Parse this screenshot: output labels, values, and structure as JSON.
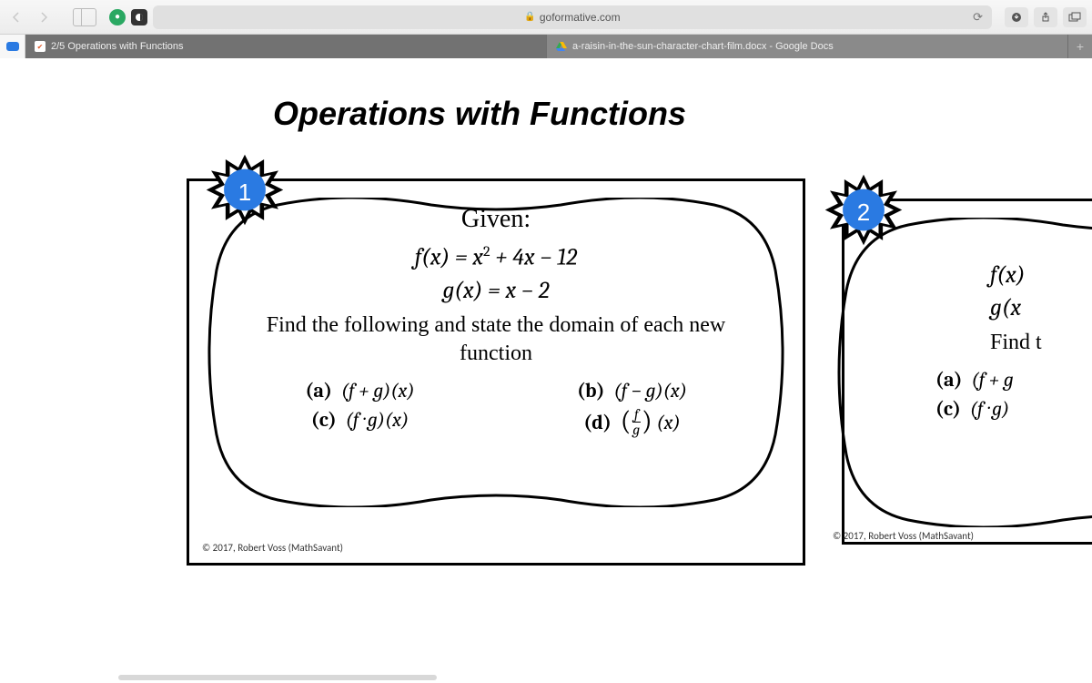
{
  "browser": {
    "url_host": "goformative.com",
    "tabs": [
      {
        "title": "2/5 Operations with Functions",
        "active": true,
        "favicon": "check"
      },
      {
        "title": "a-raisin-in-the-sun-character-chart-film.docx - Google Docs",
        "active": false,
        "favicon": "drive"
      }
    ]
  },
  "page": {
    "title": "Operations with Functions"
  },
  "cards": [
    {
      "number": "1",
      "given_label": "Given:",
      "f_def": "f(x) = x² + 4x − 12",
      "g_def": "g(x) = x − 2",
      "prompt": "Find the following and state the domain of each new function",
      "options": {
        "a": "(f + g)(x)",
        "b": "(f − g)(x)",
        "c": "(f · g)(x)",
        "d_open": "(",
        "d_num": "f",
        "d_den": "g",
        "d_close": ") (x)"
      },
      "copyright": "© 2017, Robert Voss (MathSavant)"
    },
    {
      "number": "2",
      "f_partial": "f(x)",
      "g_partial": "g(x",
      "prompt_partial": "Find t",
      "options": {
        "a": "(f + g",
        "c": "(f · g)"
      },
      "copyright": "© 2017, Robert Voss (MathSavant)"
    }
  ],
  "labels": {
    "a": "(a)",
    "b": "(b)",
    "c": "(c)",
    "d": "(d)"
  }
}
